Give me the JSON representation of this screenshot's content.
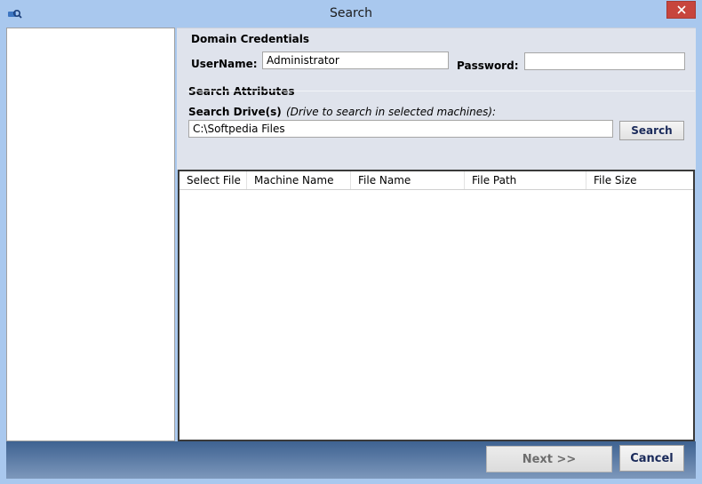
{
  "window": {
    "title": "Search"
  },
  "credentials": {
    "section_title": "Domain Credentials",
    "username_label": "UserName:",
    "username_value": "Administrator",
    "password_label": "Password:",
    "password_value": ""
  },
  "search": {
    "section_title": "Search Attributes",
    "drive_label": "Search Drive(s)",
    "drive_hint": "(Drive to search in selected machines):",
    "drive_value": "C:\\Softpedia Files",
    "search_button": "Search"
  },
  "grid": {
    "columns": [
      "Select File",
      "Machine Name",
      "File Name",
      "File Path",
      "File Size"
    ],
    "rows": []
  },
  "footer": {
    "next_button": "Next >>",
    "cancel_button": "Cancel"
  },
  "colors": {
    "window_frame": "#a9c8ee",
    "panel_background": "#dfe3ec",
    "close_button": "#c7453d",
    "footer_gradient_top": "#3e6291",
    "footer_gradient_bottom": "#7d98bb"
  }
}
